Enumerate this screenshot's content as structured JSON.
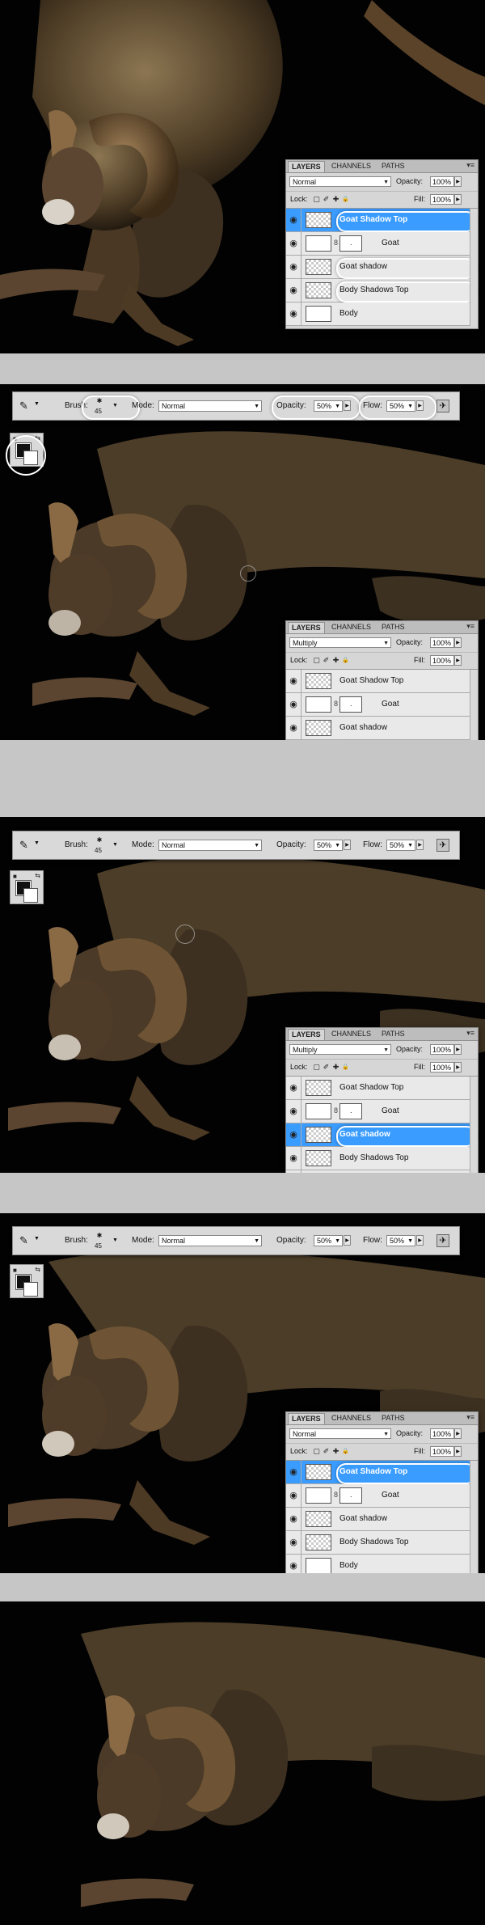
{
  "layers_panel": {
    "tabs": [
      "LAYERS",
      "CHANNELS",
      "PATHS"
    ],
    "menu_glyph": "▾≡",
    "opacity_label": "Opacity:",
    "fill_label": "Fill:",
    "lock_label": "Lock:",
    "opacity_value": "100%",
    "fill_value": "100%",
    "layer_names": [
      "Goat Shadow Top",
      "Goat",
      "Goat shadow",
      "Body Shadows Top",
      "Body"
    ],
    "mask_text": ".",
    "link_glyph": "8"
  },
  "panel_1": {
    "blend_mode": "Normal",
    "selected": "Goat Shadow Top"
  },
  "panel_2": {
    "blend_mode": "Multiply",
    "selected": "Body Shadows Top"
  },
  "panel_3": {
    "blend_mode": "Multiply",
    "selected": "Goat shadow"
  },
  "panel_4": {
    "blend_mode": "Normal",
    "selected": "Goat Shadow Top"
  },
  "options_bar": {
    "brush_label": "Brush:",
    "brush_size": "45",
    "mode_label": "Mode:",
    "mode_value": "Normal",
    "opacity_label": "Opacity:",
    "opacity_value": "50%",
    "flow_label": "Flow:",
    "flow_value": "50%"
  },
  "icons": {
    "eye": "◉",
    "brush": "✎",
    "airbrush": "✈",
    "lock_transparent": "▢",
    "lock_paint": "✐",
    "lock_move": "✚",
    "lock_all": "🔒",
    "swap": "⇆",
    "default_colors": "■"
  },
  "colors": {
    "selection": "#3a9cff",
    "foreground": "#111111",
    "background": "#ffffff"
  }
}
